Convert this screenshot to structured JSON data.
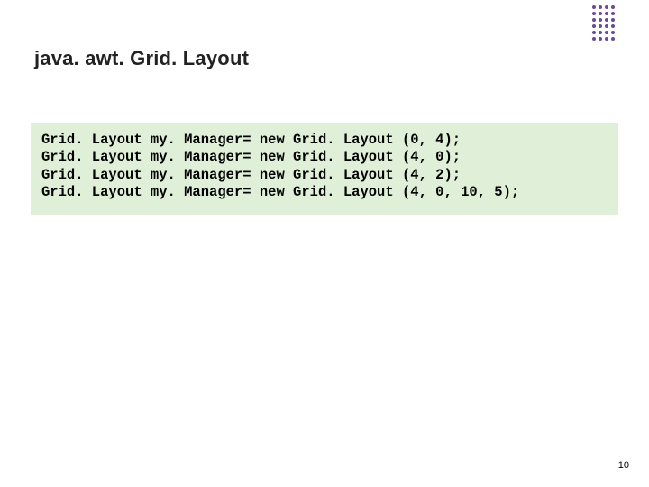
{
  "title": "java. awt. Grid. Layout",
  "code_lines": [
    "Grid. Layout my. Manager= new Grid. Layout (0, 4);",
    "Grid. Layout my. Manager= new Grid. Layout (4, 0);",
    "Grid. Layout my. Manager= new Grid. Layout (4, 2);",
    "Grid. Layout my. Manager= new Grid. Layout (4, 0, 10, 5);"
  ],
  "page_number": "10"
}
